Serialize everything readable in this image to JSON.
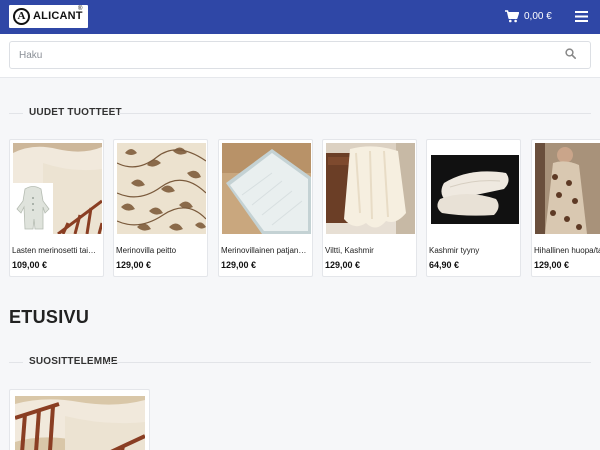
{
  "header": {
    "logo_text": "ALICANT",
    "logo_mark": "A",
    "logo_registered": "®",
    "cart_total": "0,00 €",
    "cart_icon": "cart-icon",
    "menu_icon": "hamburger-menu-icon",
    "bg_color": "#2f47a6"
  },
  "search": {
    "placeholder": "Haku",
    "value": "",
    "icon": "search-icon"
  },
  "new_products": {
    "title": "UUDET TUOTTEET",
    "items": [
      {
        "name": "Lasten merinosetti tai hihattomat",
        "price": "109,00 €"
      },
      {
        "name": "Merinovilla peitto",
        "price": "129,00 €"
      },
      {
        "name": "Merinovillainen patjansuojus",
        "price": "129,00 €"
      },
      {
        "name": "Viltti, Kashmir",
        "price": "129,00 €"
      },
      {
        "name": "Kashmir tyyny",
        "price": "64,90 €"
      },
      {
        "name": "Hihallinen huopa/takki",
        "price": "129,00 €"
      }
    ]
  },
  "page": {
    "title": "ETUSIVU"
  },
  "recommended": {
    "title": "SUOSITTELEMME"
  }
}
